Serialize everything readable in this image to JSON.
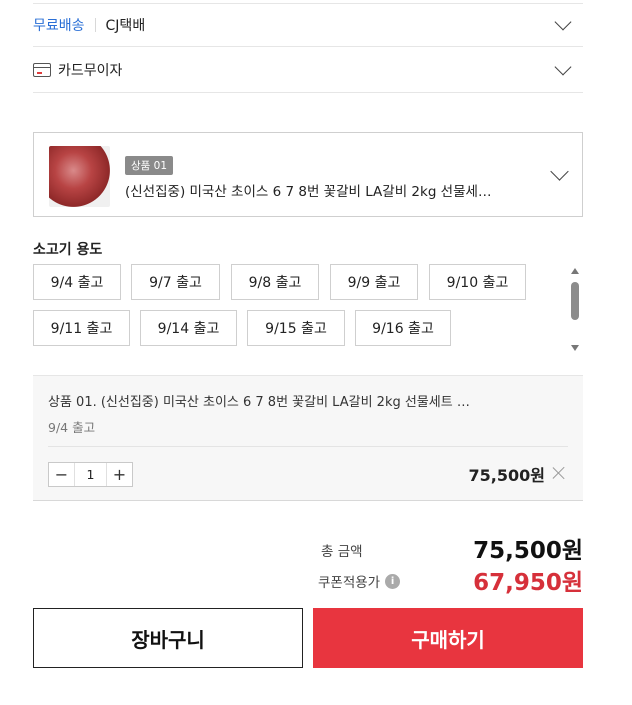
{
  "shipping": {
    "free_label": "무료배송",
    "carrier": "CJ택배"
  },
  "card_installment": {
    "icon": "card-icon",
    "label": "카드무이자"
  },
  "product_select": {
    "badge": "상품 01",
    "name": "(신선집중) 미국산 초이스 6 7 8번 꽃갈비 LA갈비 2kg 선물세…"
  },
  "options": {
    "title": "소고기 용도",
    "items": [
      "9/4 출고",
      "9/7 출고",
      "9/8 출고",
      "9/9 출고",
      "9/10 출고",
      "9/11 출고",
      "9/14 출고",
      "9/15 출고",
      "9/16 출고"
    ]
  },
  "selected_item": {
    "name": "상품 01. (신선집중) 미국산 초이스 6 7 8번 꽃갈비 LA갈비 2kg 선물세트 …",
    "option": "9/4 출고",
    "minus": "−",
    "quantity": "1",
    "plus": "+",
    "price": "75,500원"
  },
  "summary": {
    "total_label": "총 금액",
    "total_value": "75,500원",
    "coupon_label": "쿠폰적용가",
    "coupon_value": "67,950원"
  },
  "actions": {
    "cart": "장바구니",
    "buy": "구매하기"
  },
  "colors": {
    "accent_blue": "#2a6fd6",
    "buy_red": "#e8353f",
    "coupon_red": "#d6303a"
  }
}
